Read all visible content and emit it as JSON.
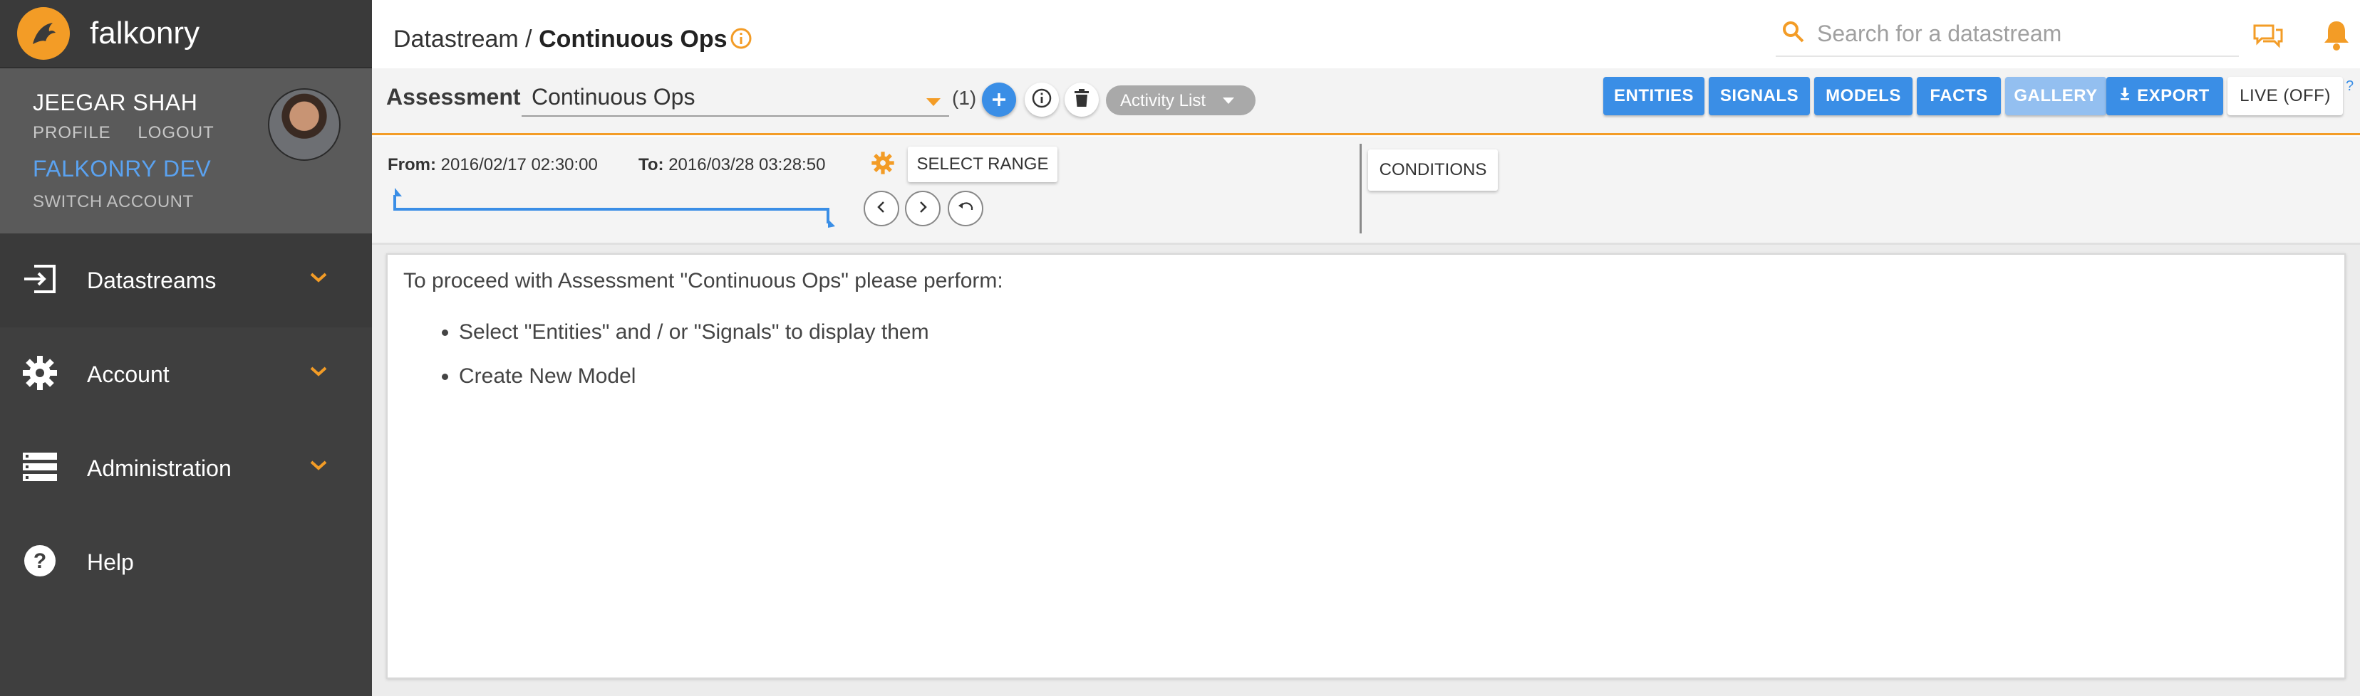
{
  "app": {
    "name": "falkonry"
  },
  "user": {
    "name": "JEEGAR SHAH",
    "profile_link": "PROFILE",
    "logout_link": "LOGOUT",
    "org": "FALKONRY DEV",
    "switch_account": "SWITCH ACCOUNT"
  },
  "sidebar": {
    "items": [
      {
        "label": "Datastreams",
        "icon": "input-icon",
        "expandable": true
      },
      {
        "label": "Account",
        "icon": "gear-icon",
        "expandable": true
      },
      {
        "label": "Administration",
        "icon": "server-list-icon",
        "expandable": true
      },
      {
        "label": "Help",
        "icon": "help-circle-icon",
        "expandable": false
      }
    ]
  },
  "header": {
    "breadcrumb_root": "Datastream",
    "breadcrumb_sep": " / ",
    "breadcrumb_current": "Continuous Ops",
    "search_placeholder": "Search for a datastream"
  },
  "assessment": {
    "label": "Assessment",
    "selected": "Continuous Ops",
    "count": "(1)",
    "activity_label": "Activity List"
  },
  "toolbar": {
    "entities": "ENTITIES",
    "signals": "SIGNALS",
    "models": "MODELS",
    "facts": "FACTS",
    "gallery": "GALLERY",
    "export": "EXPORT",
    "live": "LIVE (OFF)",
    "help": "?"
  },
  "range": {
    "from_label": "From:",
    "from_value": "2016/02/17 02:30:00",
    "to_label": "To:",
    "to_value": "2016/03/28 03:28:50",
    "select_range": "SELECT RANGE",
    "conditions": "CONDITIONS"
  },
  "content": {
    "message": "To proceed with Assessment \"Continuous Ops\" please perform:",
    "steps": [
      "Select \"Entities\" and / or \"Signals\" to display them",
      "Create New Model"
    ]
  },
  "colors": {
    "accent_orange": "#f39c26",
    "primary_blue": "#3a8ee6",
    "sidebar_bg": "#3f3f3f"
  }
}
